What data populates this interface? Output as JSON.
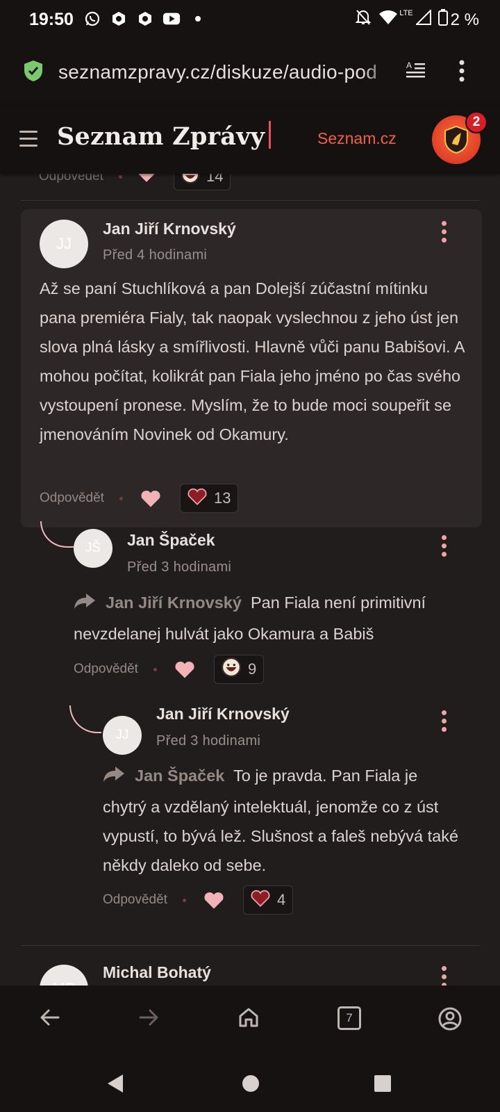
{
  "status_bar": {
    "time": "19:50",
    "network": "LTE",
    "battery": "2 %"
  },
  "browser": {
    "url": "seznamzpravy.cz/diskuze/audio-pod",
    "tab_count": "7"
  },
  "site_header": {
    "logo": "Seznam Zprávy",
    "link": "Seznam.cz",
    "notification_count": "2"
  },
  "partial_comment": {
    "reply_label": "Odpovědět",
    "reaction_count": "14"
  },
  "comments": [
    {
      "initials": "JJ",
      "author": "Jan Jiří Krnovský",
      "time": "Před 4 hodinami",
      "text": "Až se paní Stuchlíková a pan Dolejší zúčastní mítinku pana premiéra Fialy, tak naopak vyslechnou z jeho úst jen slova plná lásky a smířlivosti. Hlavně vůči panu Babišovi. A mohou počítat, kolikrát pan Fiala jeho jméno po čas svého vystoupení pronese. Myslím, že to bude moci soupeřit se jmenováním Novinek od Okamury.",
      "reply_label": "Odpovědět",
      "reaction_count": "13",
      "reaction_icon": "heart-icon"
    },
    {
      "initials": "JŠ",
      "author": "Jan Špaček",
      "time": "Před 3 hodinami",
      "reply_to": "Jan Jiří Krnovský",
      "text": "Pan Fiala není primitivní nevzdelanej hulvát jako Okamura a Babiš",
      "reply_label": "Odpovědět",
      "reaction_count": "9",
      "reaction_icon": "laughing-face-icon"
    },
    {
      "initials": "JJ",
      "author": "Jan Jiří Krnovský",
      "time": "Před 3 hodinami",
      "reply_to": "Jan Špaček",
      "text": "To je pravda. Pan Fiala je chytrý a vzdělaný intelektuál, jenomže co z úst vypustí, to bývá lež. Slušnost a faleš nebývá také někdy daleko od sebe.",
      "reply_label": "Odpovědět",
      "reaction_count": "4",
      "reaction_icon": "heart-icon"
    },
    {
      "initials": "MB",
      "author": "Michal Bohatý"
    }
  ],
  "colors": {
    "accent": "#f0a4a9",
    "brand_red": "#ee6141",
    "background": "#221d1d"
  }
}
